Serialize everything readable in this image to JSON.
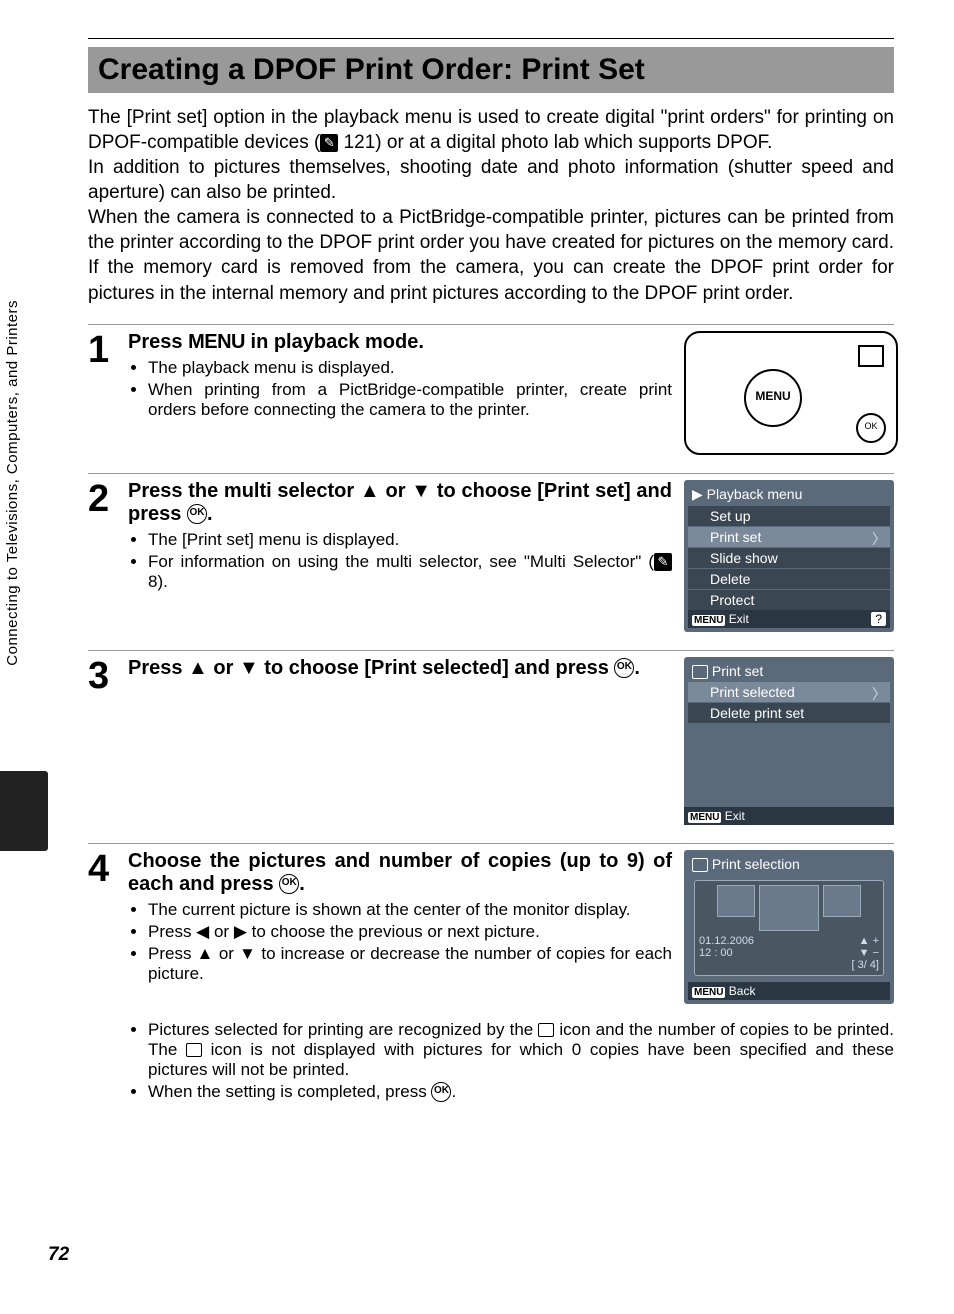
{
  "sideText": "Connecting to Televisions, Computers, and Printers",
  "pageNumber": "72",
  "title": "Creating a DPOF Print Order: Print Set",
  "intro": {
    "p1a": "The [Print set] option in the playback menu is used to create digital \"print orders\" for printing on DPOF-compatible devices (",
    "p1ref": "121",
    "p1b": ") or at a digital photo lab which supports DPOF.",
    "p2": "In addition to pictures themselves, shooting date and photo information (shutter speed and aperture) can also be printed.",
    "p3": "When the camera is connected to a PictBridge-compatible printer, pictures can be printed from the printer according to the DPOF print order you have created for pictures on the memory card. If the memory card is removed from the camera, you can create the DPOF print order for pictures in the internal memory and print pictures according to the DPOF print order."
  },
  "step1": {
    "num": "1",
    "heading_a": "Press ",
    "heading_menu": "MENU",
    "heading_b": " in playback mode.",
    "b1": "The playback menu is displayed.",
    "b2": "When printing from a PictBridge-compatible printer, create print orders before connecting the camera to the printer.",
    "illus_label": "MENU"
  },
  "step2": {
    "num": "2",
    "heading": "Press the multi selector ▲ or ▼ to choose [Print set] and press ",
    "heading_end": ".",
    "b1": "The [Print set] menu is displayed.",
    "b2a": "For information on using the multi selector, see \"Multi Selector\" (",
    "b2ref": "8",
    "b2b": ").",
    "lcd_title": "Playback menu",
    "lcd_items": [
      "Set up",
      "Print set",
      "Slide show",
      "Delete",
      "Protect"
    ],
    "lcd_exit": "Exit",
    "lcd_menu": "MENU",
    "lcd_help": "?"
  },
  "step3": {
    "num": "3",
    "heading": "Press ▲ or ▼ to choose [Print selected] and press ",
    "heading_end": ".",
    "lcd_title": "Print set",
    "lcd_items": [
      "Print selected",
      "Delete print set"
    ],
    "lcd_exit": "Exit",
    "lcd_menu": "MENU"
  },
  "step4": {
    "num": "4",
    "heading": "Choose the pictures and number of copies (up to 9) of each and press ",
    "heading_end": ".",
    "b1": "The current picture is shown at the center of the monitor display.",
    "b2": "Press ◀ or ▶ to choose the previous or next picture.",
    "b3": "Press ▲ or ▼ to increase or decrease the number of copies for each picture.",
    "b4a": "Pictures selected for printing are recognized by the ",
    "b4b": " icon and the number of copies to be printed. The ",
    "b4c": " icon is not displayed with pictures for which 0 copies have been specified and these pictures will not be printed.",
    "b5": "When the setting is completed, press ",
    "b5end": ".",
    "lcd_title": "Print selection",
    "lcd_date": "01.12.2006",
    "lcd_time": "12 : 00",
    "lcd_count": "[      3/      4]",
    "lcd_back": "Back",
    "lcd_menu": "MENU",
    "lcd_plus": "+",
    "lcd_minus": "−"
  }
}
